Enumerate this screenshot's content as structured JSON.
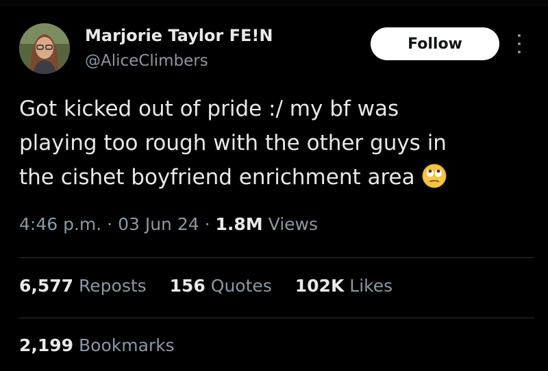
{
  "author": {
    "display_name": "Marjorie Taylor FE!N",
    "handle": "@AliceClimbers"
  },
  "follow_label": "Follow",
  "tweet": {
    "lines": [
      "Got kicked out of pride :/ my bf was",
      "playing too rough with the other guys in",
      "the cishet boyfriend enrichment area"
    ],
    "emoji": "eye-roll-emoji"
  },
  "meta": {
    "time": "4:46 p.m.",
    "separator": "·",
    "date": "03 Jun 24",
    "views_count": "1.8M",
    "views_label": "Views"
  },
  "stats": {
    "reposts_count": "6,577",
    "reposts_label": "Reposts",
    "quotes_count": "156",
    "quotes_label": "Quotes",
    "likes_count": "102K",
    "likes_label": "Likes",
    "bookmarks_count": "2,199",
    "bookmarks_label": "Bookmarks"
  },
  "colors": {
    "background": "#000000",
    "text_primary": "#e7e9ea",
    "text_secondary": "#8b98a5",
    "divider": "#2f3336",
    "button_bg": "#ffffff"
  }
}
